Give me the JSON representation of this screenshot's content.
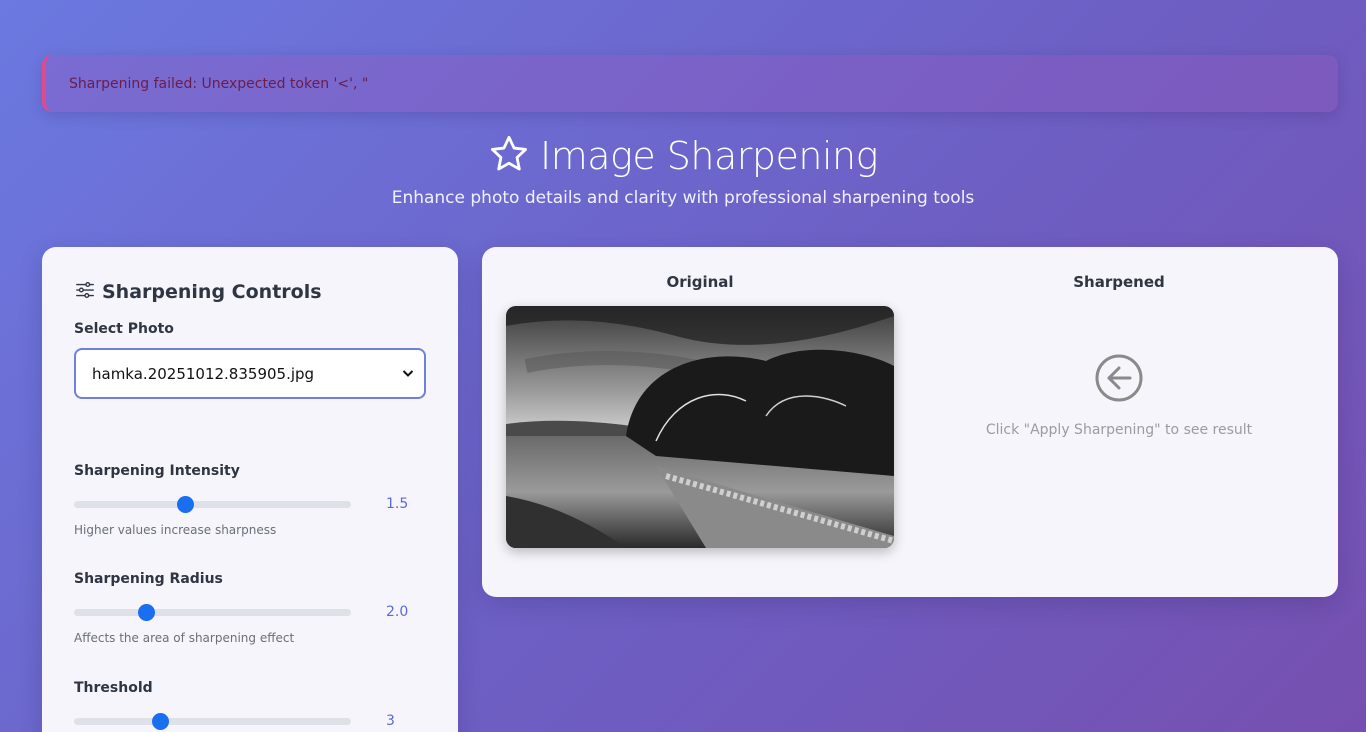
{
  "alert": {
    "message": "Sharpening failed: Unexpected token '<', \""
  },
  "header": {
    "title": "Image Sharpening",
    "subtitle": "Enhance photo details and clarity with professional sharpening tools",
    "icon": "star-icon"
  },
  "controls": {
    "title": "Sharpening Controls",
    "icon": "sliders-icon",
    "select_label": "Select Photo",
    "selected_photo": "hamka.20251012.835905.jpg",
    "sliders": [
      {
        "label": "Sharpening Intensity",
        "value": "1.5",
        "fraction": 0.4,
        "hint": "Higher values increase sharpness"
      },
      {
        "label": "Sharpening Radius",
        "value": "2.0",
        "fraction": 0.26,
        "hint": "Affects the area of sharpening effect"
      },
      {
        "label": "Threshold",
        "value": "3",
        "fraction": 0.31,
        "hint": ""
      }
    ]
  },
  "preview": {
    "original_label": "Original",
    "sharpened_label": "Sharpened",
    "empty_message": "Click \"Apply Sharpening\" to see result",
    "empty_icon": "arrow-left-circle-icon",
    "photo_description_icon": "landscape-photo"
  }
}
